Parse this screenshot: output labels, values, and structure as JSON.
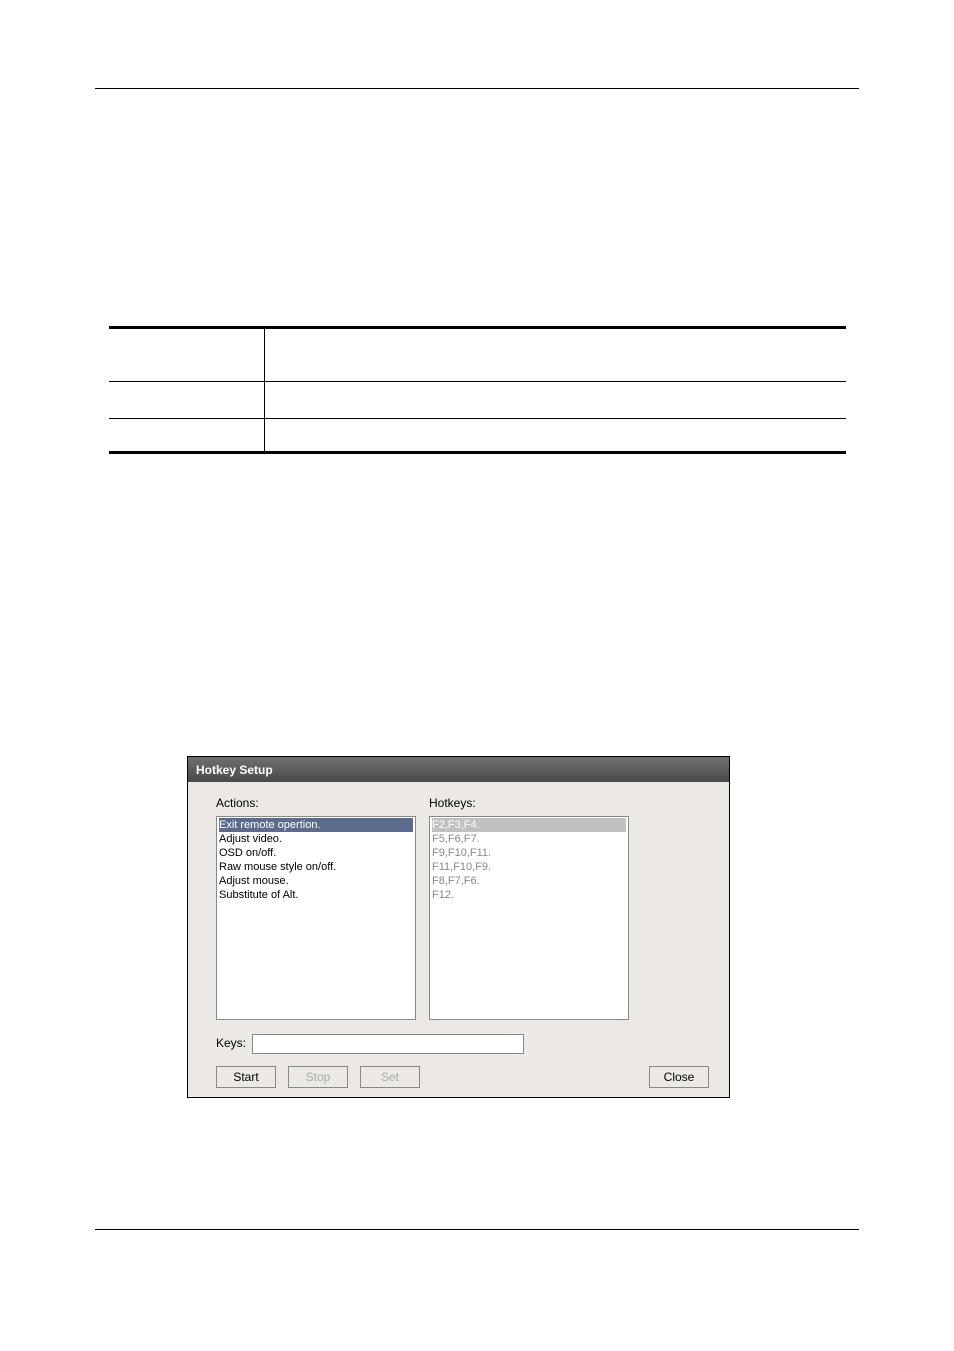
{
  "dialog": {
    "title": "Hotkey Setup",
    "labels": {
      "actions": "Actions:",
      "hotkeys": "Hotkeys:",
      "keys": "Keys:"
    },
    "actions_list": [
      "Exit remote opertion.",
      "Adjust video.",
      "OSD on/off.",
      "Raw mouse style on/off.",
      "Adjust mouse.",
      "Substitute of Alt."
    ],
    "hotkeys_list": [
      "F2,F3,F4.",
      "F5,F6,F7.",
      "F9,F10,F11.",
      "F11,F10,F9.",
      "F8,F7,F6.",
      "F12."
    ],
    "keys_value": "",
    "buttons": {
      "start": "Start",
      "stop": "Stop",
      "set": "Set",
      "close": "Close"
    }
  }
}
